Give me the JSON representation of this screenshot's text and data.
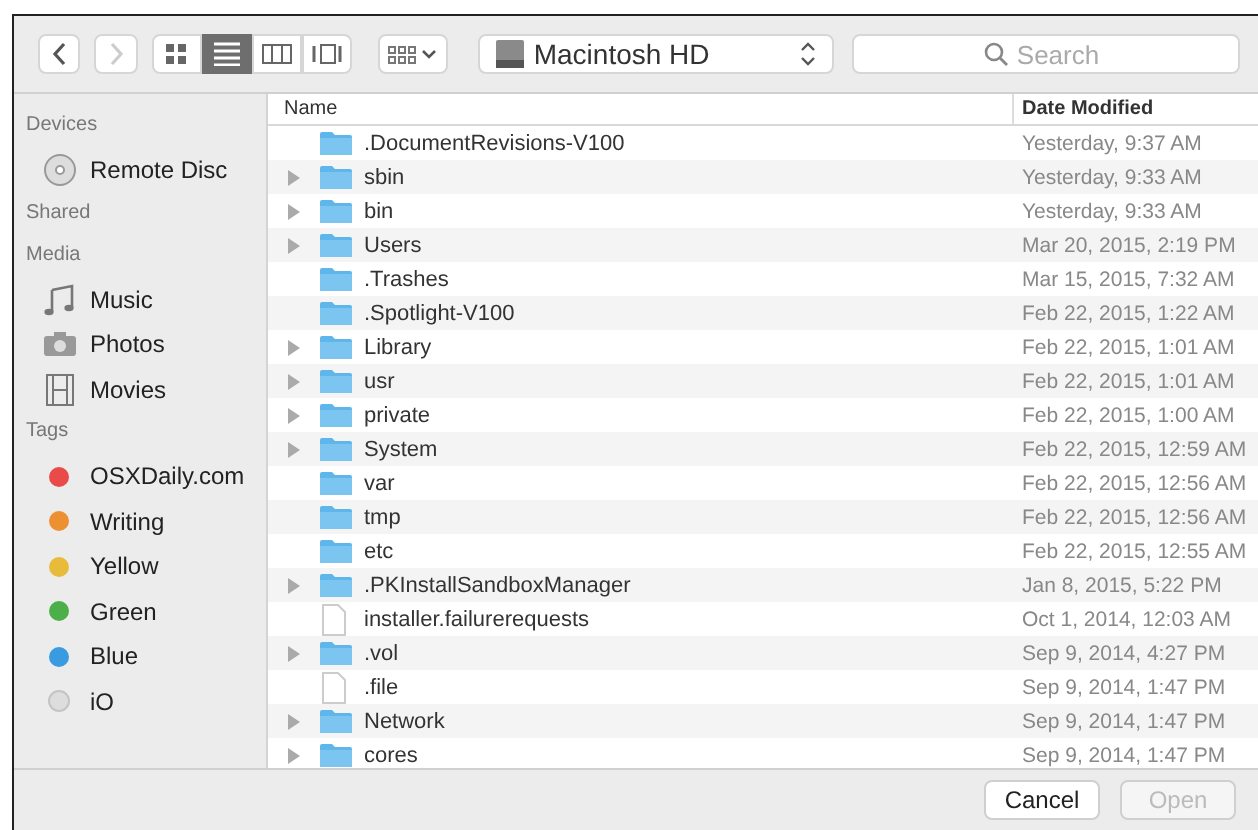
{
  "toolbar": {
    "back": {
      "disabled": false
    },
    "forward": {
      "disabled": true
    },
    "views": [
      {
        "kind": "icon",
        "selected": false
      },
      {
        "kind": "list",
        "selected": true
      },
      {
        "kind": "column",
        "selected": false
      },
      {
        "kind": "coverflow",
        "selected": false
      }
    ],
    "location": "Macintosh HD",
    "search": {
      "placeholder": "Search"
    }
  },
  "sidebar": [
    {
      "title": "Devices",
      "items": [
        {
          "label": "Remote Disc",
          "kind": "disc"
        }
      ]
    },
    {
      "title": "Shared"
    },
    {
      "title": "Media",
      "items": [
        {
          "label": "Music",
          "kind": "music"
        },
        {
          "label": "Photos",
          "kind": "photos"
        },
        {
          "label": "Movies",
          "kind": "movies"
        }
      ]
    },
    {
      "title": "Tags",
      "items": [
        {
          "label": "OSXDaily.com",
          "kind": "tag",
          "color": "#e94a4a"
        },
        {
          "label": "Writing",
          "kind": "tag",
          "color": "#ec9032"
        },
        {
          "label": "Yellow",
          "kind": "tag",
          "color": "#e8bb3a"
        },
        {
          "label": "Green",
          "kind": "tag",
          "color": "#4caf4a"
        },
        {
          "label": "Blue",
          "kind": "tag",
          "color": "#3a9be0"
        },
        {
          "label": "iO",
          "kind": "tag",
          "color": "#dddddd"
        }
      ]
    }
  ],
  "file_list": {
    "columns": [
      "Name",
      "Date Modified"
    ],
    "rows": [
      {
        "name": ".DocumentRevisions-V100",
        "date": "Yesterday, 9:37 AM",
        "kind": "folder",
        "expandable": false
      },
      {
        "name": "sbin",
        "date": "Yesterday, 9:33 AM",
        "kind": "folder",
        "expandable": true
      },
      {
        "name": "bin",
        "date": "Yesterday, 9:33 AM",
        "kind": "folder",
        "expandable": true
      },
      {
        "name": "Users",
        "date": "Mar 20, 2015, 2:19 PM",
        "kind": "folder",
        "expandable": true
      },
      {
        "name": ".Trashes",
        "date": "Mar 15, 2015, 7:32 AM",
        "kind": "folder",
        "expandable": false
      },
      {
        "name": ".Spotlight-V100",
        "date": "Feb 22, 2015, 1:22 AM",
        "kind": "folder",
        "expandable": false
      },
      {
        "name": "Library",
        "date": "Feb 22, 2015, 1:01 AM",
        "kind": "folder",
        "expandable": true
      },
      {
        "name": "usr",
        "date": "Feb 22, 2015, 1:01 AM",
        "kind": "folder",
        "expandable": true
      },
      {
        "name": "private",
        "date": "Feb 22, 2015, 1:00 AM",
        "kind": "folder",
        "expandable": true
      },
      {
        "name": "System",
        "date": "Feb 22, 2015, 12:59 AM",
        "kind": "folder",
        "expandable": true
      },
      {
        "name": "var",
        "date": "Feb 22, 2015, 12:56 AM",
        "kind": "folder",
        "expandable": false
      },
      {
        "name": "tmp",
        "date": "Feb 22, 2015, 12:56 AM",
        "kind": "folder",
        "expandable": false
      },
      {
        "name": "etc",
        "date": "Feb 22, 2015, 12:55 AM",
        "kind": "folder",
        "expandable": false
      },
      {
        "name": ".PKInstallSandboxManager",
        "date": "Jan 8, 2015, 5:22 PM",
        "kind": "folder",
        "expandable": true
      },
      {
        "name": "installer.failurerequests",
        "date": "Oct 1, 2014, 12:03 AM",
        "kind": "file",
        "expandable": false
      },
      {
        "name": ".vol",
        "date": "Sep 9, 2014, 4:27 PM",
        "kind": "folder",
        "expandable": true
      },
      {
        "name": ".file",
        "date": "Sep 9, 2014, 1:47 PM",
        "kind": "file",
        "expandable": false
      },
      {
        "name": "Network",
        "date": "Sep 9, 2014, 1:47 PM",
        "kind": "folder",
        "expandable": true
      },
      {
        "name": "cores",
        "date": "Sep 9, 2014, 1:47 PM",
        "kind": "folder",
        "expandable": true
      }
    ]
  },
  "footer": {
    "buttons": [
      {
        "label": "Cancel",
        "disabled": false
      },
      {
        "label": "Open",
        "disabled": true
      }
    ]
  }
}
